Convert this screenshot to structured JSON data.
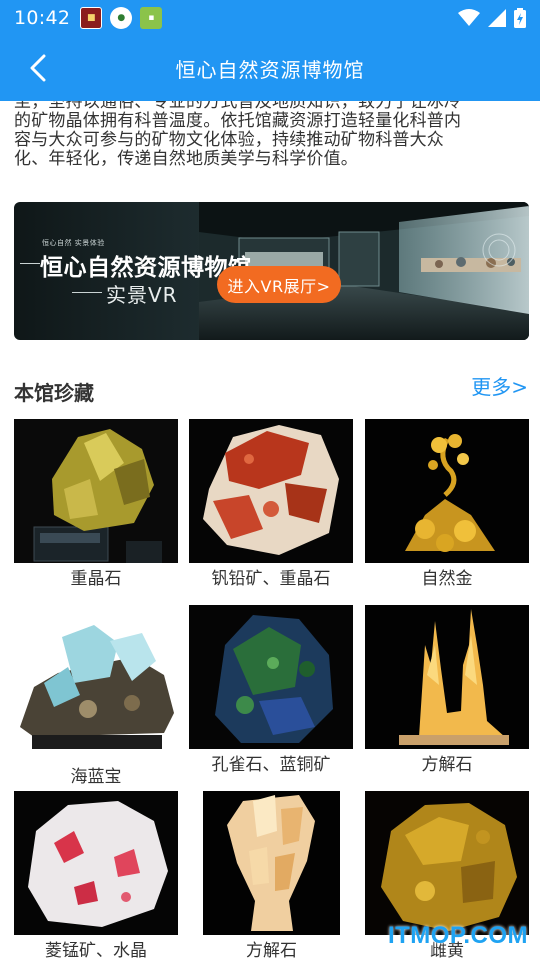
{
  "status": {
    "time": "10:42"
  },
  "header": {
    "title": "恒心自然资源博物馆"
  },
  "intro": {
    "lines": [
      "至，坚持以通俗、专业的方式普及地质知识，致力于让冰冷",
      "的矿物晶体拥有科普温度。依托馆藏资源打造轻量化科普内",
      "容与大众可参与的矿物文化体验，持续推动矿物科普大众",
      "化、年轻化，传递自然地质美学与科学价值。"
    ]
  },
  "vr": {
    "small_caption": "恒心自然 实景体验",
    "title": "恒心自然资源博物馆",
    "subtitle": "实景VR",
    "button": "进入VR展厅>"
  },
  "collection": {
    "title": "本馆珍藏",
    "more": "更多>",
    "items": [
      {
        "name": "重晶石",
        "icon": "barite-photo"
      },
      {
        "name": "钒铅矿、重晶石",
        "icon": "vanadinite-photo"
      },
      {
        "name": "自然金",
        "icon": "gold-photo"
      },
      {
        "name": "海蓝宝",
        "icon": "aquamarine-photo"
      },
      {
        "name": "孔雀石、蓝铜矿",
        "icon": "malachite-photo"
      },
      {
        "name": "方解石",
        "icon": "calcite-photo"
      },
      {
        "name": "菱锰矿、水晶",
        "icon": "rhodochrosite-photo"
      },
      {
        "name": "方解石",
        "icon": "calcite-photo-2"
      },
      {
        "name": "雌黄",
        "icon": "orpiment-photo"
      }
    ]
  },
  "watermark": "ITMOP.COM",
  "colors": {
    "primary": "#2196f3",
    "accent": "#f26b21",
    "text": "#333333"
  }
}
